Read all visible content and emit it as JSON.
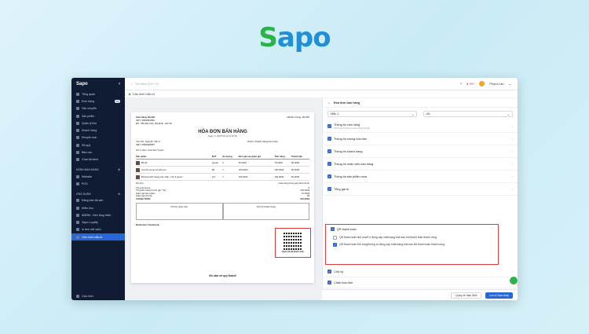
{
  "brand": {
    "logo_s": "S",
    "logo_rest": "apo",
    "logo_color_green": "#2bb34a",
    "logo_color_blue": "#1f8fd6"
  },
  "sidebar": {
    "logo": "Sapo",
    "items": [
      {
        "label": "Tổng quan",
        "icon": "dashboard-icon"
      },
      {
        "label": "Đơn hàng",
        "icon": "order-icon",
        "badge": "19"
      },
      {
        "label": "Vận chuyển",
        "icon": "truck-icon"
      },
      {
        "label": "Sản phẩm",
        "icon": "box-icon"
      },
      {
        "label": "Quản lý kho",
        "icon": "warehouse-icon"
      },
      {
        "label": "Khách hàng",
        "icon": "user-icon"
      },
      {
        "label": "Khuyến mại",
        "icon": "discount-icon"
      },
      {
        "label": "Sổ quỹ",
        "icon": "wallet-icon"
      },
      {
        "label": "Báo cáo",
        "icon": "report-icon"
      },
      {
        "label": "Chat đa kênh",
        "icon": "chat-icon"
      }
    ],
    "section_sales": "KÊNH BÁN HÀNG",
    "sales_items": [
      {
        "label": "Website"
      },
      {
        "label": "POS"
      }
    ],
    "section_apps": "ỨNG DỤNG",
    "app_items": [
      {
        "label": "Đăng bán đa sàn"
      },
      {
        "label": "Kiểm kho"
      },
      {
        "label": "AMRM - Nền tảng thiết..."
      },
      {
        "label": "Sapo Loyalty"
      },
      {
        "label": "In tem mã vạch"
      },
      {
        "label": "Cấu hình mẫu in",
        "active": true
      }
    ],
    "settings": "Cấu hình"
  },
  "topbar": {
    "search_placeholder": "Tìm kiếm (Ctrl + K)",
    "notif_count": "99+",
    "user_name": "Phạm Lan"
  },
  "breadcrumb": "Cấu hình mẫu in",
  "invoice": {
    "store_name": "Cửa hàng Hà Nội",
    "store_phone": "SĐT: 0999999982",
    "store_addr": "ĐC: 256 Đội Cấn, Ba Đình, Hà Nội",
    "order_code": "Mã đơn hàng: #9 000",
    "title": "HÓA ĐƠN BÁN HÀNG",
    "date": "Ngày in: 2025-05-12 10:02:35",
    "customer": "Tên KH: Nguyễn Văn A",
    "customer_phone": "SĐT: 0999999987",
    "category": "Nhóm: Khách hàng bán buôn",
    "seller": "NV in đơn: Cửa tiền Tuyến",
    "headers": [
      "Sản phẩm",
      "ĐVT",
      "Số lượng",
      "Đơn giá sau giảm giá",
      "Tiền hàng",
      "Thành tiền"
    ],
    "rows": [
      [
        "Bồ đá",
        "Quyển",
        "3",
        "25.000đ",
        "75.000đ",
        "90.000đ"
      ],
      [
        "Combo cả set sổ viết tool",
        "Bộ",
        "1",
        "100.000đ",
        "100.000đ",
        "90.000đ"
      ],
      [
        "Bổ Hoa Xinh Sang Cao Cấp - Lốc 3 quyển",
        "Lốc",
        "1",
        "100.000đ",
        "100.000đ",
        "60.000đ"
      ]
    ],
    "note_label": "Ghi chú",
    "note_value": "Giao hàng trong giờ hành chính",
    "totals": [
      [
        "Tổng số lượng",
        "5"
      ],
      [
        "Tổng tiền hàng (trước giá * SL)",
        "225.000đ"
      ],
      [
        "Giảm giá trên phiếu",
        "15.000đ"
      ],
      [
        "Giảm giá tích lũy",
        "0đ"
      ]
    ],
    "pay_label": "THANH TOÁN",
    "pay_value": "210.000đ",
    "sign_buyer": "Chữ ký nhân viên",
    "sign_seller": "Chữ ký khách hàng",
    "channel": "Kênh bán: Facebook",
    "qr_caption": "Quét mã để thanh toán",
    "thanks": "Xin cảm ơn quý khách!"
  },
  "panel": {
    "title": "Hóa đơn bán hàng",
    "template": "Mẫu 1",
    "paper": "A4",
    "sections": [
      {
        "title": "Thông tin cửa hàng",
        "desc": "Chỉnh sửa thông tin cửa hàng tại đây",
        "checked": true
      },
      {
        "title": "Thông tin chung hóa đơn",
        "desc": "",
        "checked": true
      },
      {
        "title": "Thông tin khách hàng",
        "desc": "",
        "checked": true
      },
      {
        "title": "Thông tin nhân viên bán hàng",
        "desc": "",
        "checked": true
      },
      {
        "title": "Thông tin sản phẩm mua",
        "desc": "",
        "checked": true
      },
      {
        "title": "Tổng giá trị",
        "desc": "",
        "checked": true
      }
    ],
    "qr_section": "QR thanh toán",
    "qr_options": [
      {
        "title": "QR thanh toán linh hoạt",
        "desc": "Tự động cập nhật trạng thái sau khi thanh toán thành công",
        "checked": false
      },
      {
        "title": "QR thanh toán thủ công",
        "desc": "Không tự động cập nhật trạng thái sau khi thanh toán thành công",
        "checked": true
      }
    ],
    "after_sections": [
      {
        "title": "Chữ ký",
        "checked": true
      },
      {
        "title": "Chân hóa đơn",
        "checked": true
      }
    ],
    "btn_reset": "Quay về mặc định",
    "btn_save": "Lưu & Sao chép"
  }
}
